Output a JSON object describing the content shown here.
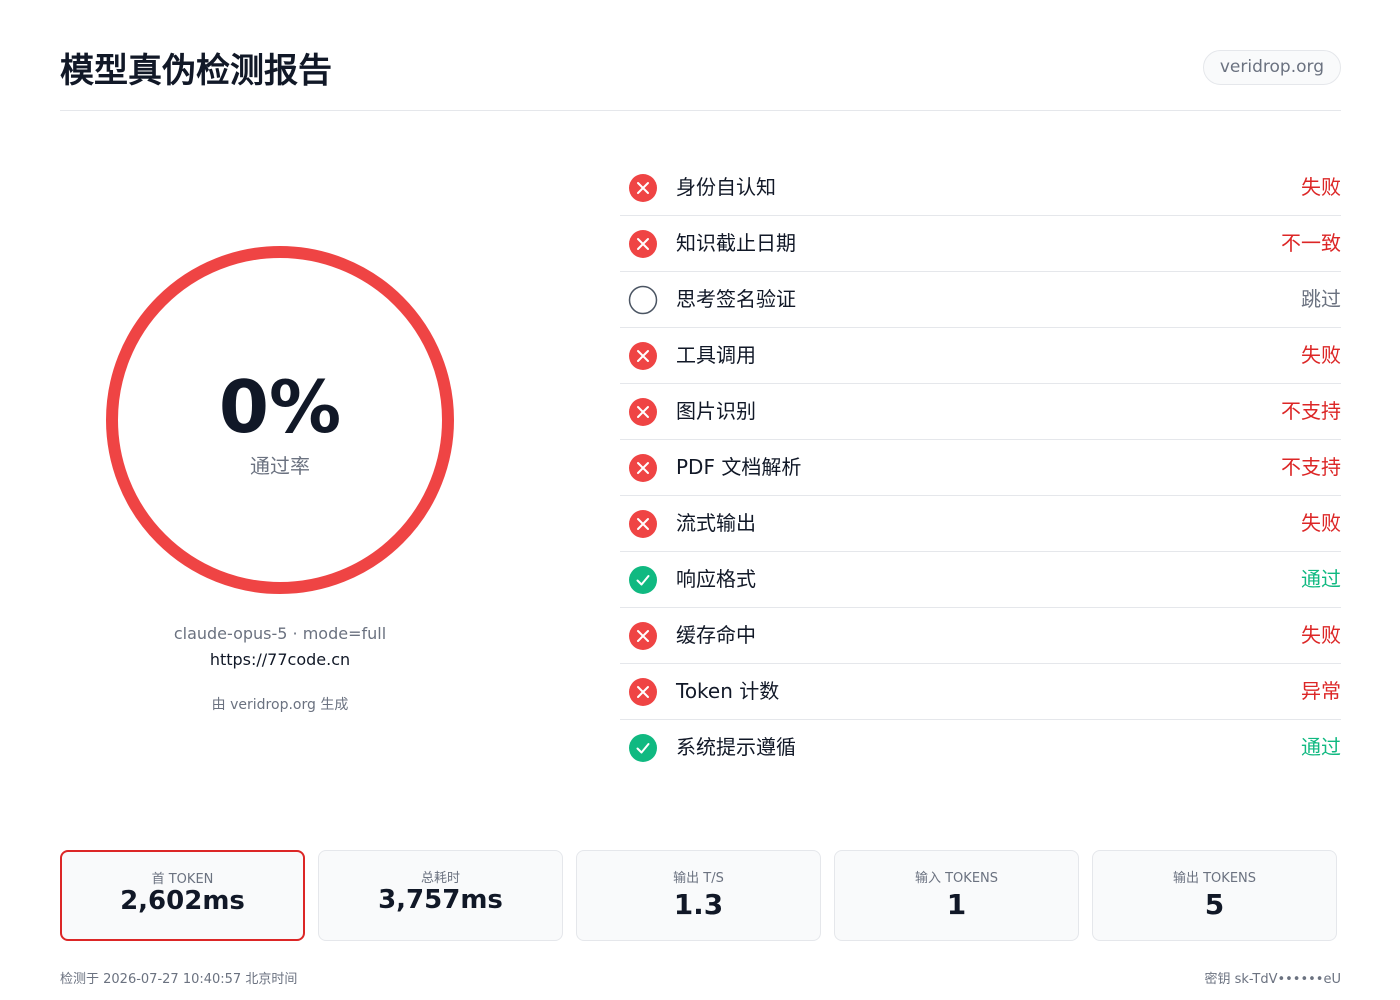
{
  "header": {
    "title": "模型真伪检测报告",
    "domain": "veridrop.org"
  },
  "score": {
    "value": "0%",
    "label": "通过率",
    "fraction": 0.0,
    "ring_color": "#ef4444"
  },
  "model_info": {
    "meta": "claude-opus-5 · mode=full",
    "endpoint": "https://77code.cn",
    "powered_by": "由 veridrop.org 生成"
  },
  "checks": [
    {
      "name": "身份自认知",
      "status": "失败",
      "state": "fail",
      "icon": "x-circle-icon"
    },
    {
      "name": "知识截止日期",
      "status": "不一致",
      "state": "fail",
      "icon": "x-circle-icon"
    },
    {
      "name": "思考签名验证",
      "status": "跳过",
      "state": "skip",
      "icon": "empty-circle-icon"
    },
    {
      "name": "工具调用",
      "status": "失败",
      "state": "fail",
      "icon": "x-circle-icon"
    },
    {
      "name": "图片识别",
      "status": "不支持",
      "state": "fail",
      "icon": "x-circle-icon"
    },
    {
      "name": "PDF 文档解析",
      "status": "不支持",
      "state": "fail",
      "icon": "x-circle-icon"
    },
    {
      "name": "流式输出",
      "status": "失败",
      "state": "fail",
      "icon": "x-circle-icon"
    },
    {
      "name": "响应格式",
      "status": "通过",
      "state": "pass",
      "icon": "check-circle-icon"
    },
    {
      "name": "缓存命中",
      "status": "失败",
      "state": "fail",
      "icon": "x-circle-icon"
    },
    {
      "name": "Token 计数",
      "status": "异常",
      "state": "fail",
      "icon": "x-circle-icon"
    },
    {
      "name": "系统提示遵循",
      "status": "通过",
      "state": "pass",
      "icon": "check-circle-icon"
    }
  ],
  "metrics": [
    {
      "label": "首 TOKEN",
      "value": "2,602ms"
    },
    {
      "label": "总耗时",
      "value": "3,757ms"
    },
    {
      "label": "输出 T/S",
      "value": "1.3"
    },
    {
      "label": "输入 TOKENS",
      "value": "1"
    },
    {
      "label": "输出 TOKENS",
      "value": "5"
    }
  ],
  "footer": {
    "left": "检测于 2026-07-27 10:40:57 北京时间",
    "right": "密钥 sk-TdV••••••eU"
  },
  "colors": {
    "fail": "#ef4444",
    "pass": "#10b981",
    "skip": "#6b7280"
  }
}
